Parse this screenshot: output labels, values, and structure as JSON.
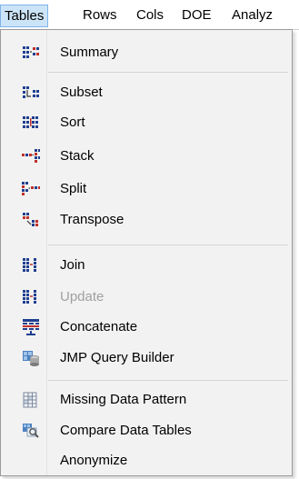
{
  "menubar": {
    "items": [
      "Tables",
      "Rows",
      "Cols",
      "DOE",
      "Analyz"
    ]
  },
  "menu": {
    "items": [
      {
        "label": "Summary",
        "icon": "summary-icon",
        "enabled": true
      },
      {
        "label": "Subset",
        "icon": "subset-icon",
        "enabled": true
      },
      {
        "label": "Sort",
        "icon": "sort-icon",
        "enabled": true
      },
      {
        "label": "Stack",
        "icon": "stack-icon",
        "enabled": true
      },
      {
        "label": "Split",
        "icon": "split-icon",
        "enabled": true
      },
      {
        "label": "Transpose",
        "icon": "transpose-icon",
        "enabled": true
      },
      {
        "label": "Join",
        "icon": "join-icon",
        "enabled": true
      },
      {
        "label": "Update",
        "icon": "update-icon",
        "enabled": false
      },
      {
        "label": "Concatenate",
        "icon": "concatenate-icon",
        "enabled": true
      },
      {
        "label": "JMP Query Builder",
        "icon": "query-builder-icon",
        "enabled": true
      },
      {
        "label": "Missing Data Pattern",
        "icon": "missing-data-icon",
        "enabled": true
      },
      {
        "label": "Compare Data Tables",
        "icon": "compare-tables-icon",
        "enabled": true
      },
      {
        "label": "Anonymize",
        "icon": "",
        "enabled": true
      }
    ]
  },
  "colors": {
    "highlight": "#cce4f7",
    "highlight_border": "#7eb4ea",
    "menu_bg": "#f2f2f2",
    "icon_blue": "#1f3f8f",
    "icon_red": "#c0302a",
    "disabled_text": "#a0a0a0"
  }
}
